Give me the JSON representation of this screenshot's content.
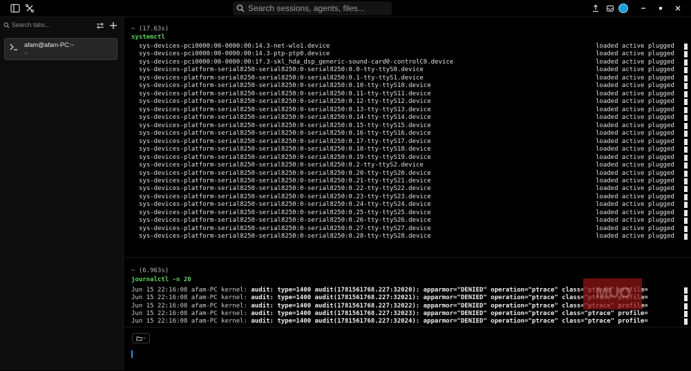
{
  "topbar": {
    "search_placeholder": "Search sessions, agents, files...",
    "accent": "#1e9fd8"
  },
  "sidebar": {
    "search_placeholder": "Search tabs...",
    "tabs": [
      {
        "title": "afam@afam-PC:~",
        "subtitle": "~"
      }
    ]
  },
  "blocks": {
    "systemctl": {
      "duration": "~ (17.63s)",
      "command": "systemctl",
      "rows": [
        {
          "unit": "sys-devices-pci0000:00-0000:00:14.3-net-wlo1.device",
          "state": "loaded active plugged"
        },
        {
          "unit": "sys-devices-pci0000:00-0000:00:14.3-ptp-ptp0.device",
          "state": "loaded active plugged"
        },
        {
          "unit": "sys-devices-pci0000:00-0000:00:1f.3-skl_hda_dsp_generic-sound-card0-controlC0.device",
          "state": "loaded active plugged"
        },
        {
          "unit": "sys-devices-platform-serial8250-serial8250:0-serial8250:0.0-tty-ttyS0.device",
          "state": "loaded active plugged"
        },
        {
          "unit": "sys-devices-platform-serial8250-serial8250:0-serial8250:0.1-tty-ttyS1.device",
          "state": "loaded active plugged"
        },
        {
          "unit": "sys-devices-platform-serial8250-serial8250:0-serial8250:0.10-tty-ttyS10.device",
          "state": "loaded active plugged"
        },
        {
          "unit": "sys-devices-platform-serial8250-serial8250:0-serial8250:0.11-tty-ttyS11.device",
          "state": "loaded active plugged"
        },
        {
          "unit": "sys-devices-platform-serial8250-serial8250:0-serial8250:0.12-tty-ttyS12.device",
          "state": "loaded active plugged"
        },
        {
          "unit": "sys-devices-platform-serial8250-serial8250:0-serial8250:0.13-tty-ttyS13.device",
          "state": "loaded active plugged"
        },
        {
          "unit": "sys-devices-platform-serial8250-serial8250:0-serial8250:0.14-tty-ttyS14.device",
          "state": "loaded active plugged"
        },
        {
          "unit": "sys-devices-platform-serial8250-serial8250:0-serial8250:0.15-tty-ttyS15.device",
          "state": "loaded active plugged"
        },
        {
          "unit": "sys-devices-platform-serial8250-serial8250:0-serial8250:0.16-tty-ttyS16.device",
          "state": "loaded active plugged"
        },
        {
          "unit": "sys-devices-platform-serial8250-serial8250:0-serial8250:0.17-tty-ttyS17.device",
          "state": "loaded active plugged"
        },
        {
          "unit": "sys-devices-platform-serial8250-serial8250:0-serial8250:0.18-tty-ttyS18.device",
          "state": "loaded active plugged"
        },
        {
          "unit": "sys-devices-platform-serial8250-serial8250:0-serial8250:0.19-tty-ttyS19.device",
          "state": "loaded active plugged"
        },
        {
          "unit": "sys-devices-platform-serial8250-serial8250:0-serial8250:0.2-tty-ttyS2.device",
          "state": "loaded active plugged"
        },
        {
          "unit": "sys-devices-platform-serial8250-serial8250:0-serial8250:0.20-tty-ttyS20.device",
          "state": "loaded active plugged"
        },
        {
          "unit": "sys-devices-platform-serial8250-serial8250:0-serial8250:0.21-tty-ttyS21.device",
          "state": "loaded active plugged"
        },
        {
          "unit": "sys-devices-platform-serial8250-serial8250:0-serial8250:0.22-tty-ttyS22.device",
          "state": "loaded active plugged"
        },
        {
          "unit": "sys-devices-platform-serial8250-serial8250:0-serial8250:0.23-tty-ttyS23.device",
          "state": "loaded active plugged"
        },
        {
          "unit": "sys-devices-platform-serial8250-serial8250:0-serial8250:0.24-tty-ttyS24.device",
          "state": "loaded active plugged"
        },
        {
          "unit": "sys-devices-platform-serial8250-serial8250:0-serial8250:0.25-tty-ttyS25.device",
          "state": "loaded active plugged"
        },
        {
          "unit": "sys-devices-platform-serial8250-serial8250:0-serial8250:0.26-tty-ttyS26.device",
          "state": "loaded active plugged"
        },
        {
          "unit": "sys-devices-platform-serial8250-serial8250:0-serial8250:0.27-tty-ttyS27.device",
          "state": "loaded active plugged"
        },
        {
          "unit": "sys-devices-platform-serial8250-serial8250:0-serial8250:0.28-tty-ttyS28.device",
          "state": "loaded active plugged"
        }
      ]
    },
    "journalctl": {
      "duration": "~ (6.963s)",
      "command": "journalctl -n 20",
      "rows": [
        {
          "prefix": "Jun 15 22:16:08 afam-PC kernel: ",
          "body": "audit: type=1400 audit(1781561768.227:32020): apparmor=\"DENIED\" operation=\"ptrace\" class=\"ptrace\" profile="
        },
        {
          "prefix": "Jun 15 22:16:08 afam-PC kernel: ",
          "body": "audit: type=1400 audit(1781561768.227:32021): apparmor=\"DENIED\" operation=\"ptrace\" class=\"ptrace\" profile="
        },
        {
          "prefix": "Jun 15 22:16:08 afam-PC kernel: ",
          "body": "audit: type=1400 audit(1781561768.227:32022): apparmor=\"DENIED\" operation=\"ptrace\" class=\"ptrace\" profile="
        },
        {
          "prefix": "Jun 15 22:16:08 afam-PC kernel: ",
          "body": "audit: type=1400 audit(1781561768.227:32023): apparmor=\"DENIED\" operation=\"ptrace\" class=\"ptrace\" profile="
        },
        {
          "prefix": "Jun 15 22:16:08 afam-PC kernel: ",
          "body": "audit: type=1400 audit(1781561768.227:32024): apparmor=\"DENIED\" operation=\"ptrace\" class=\"ptrace\" profile="
        }
      ]
    }
  },
  "input": {
    "dir_label": "~"
  }
}
